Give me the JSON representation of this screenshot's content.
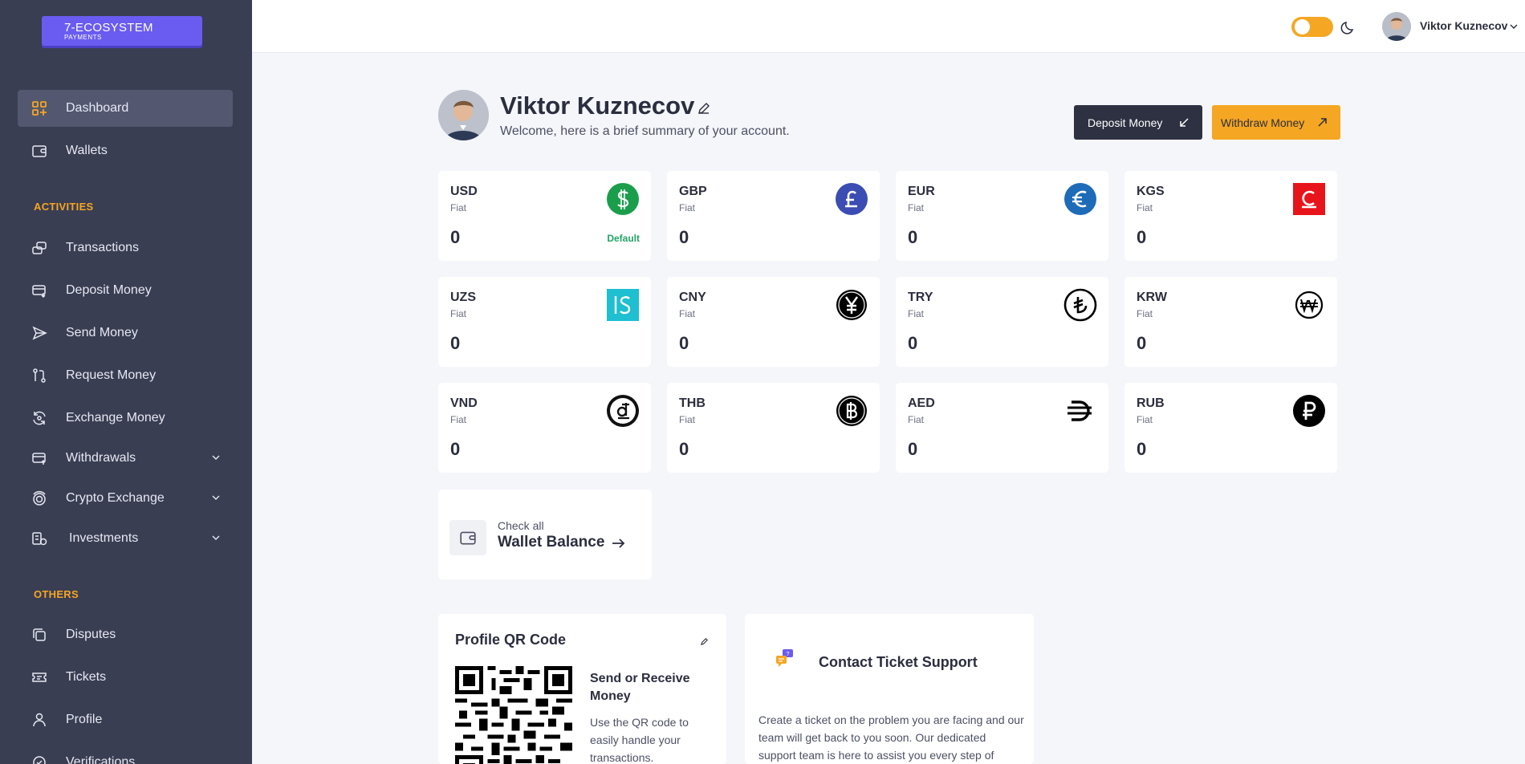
{
  "brand": {
    "line1": "7-ECOSYSTEM",
    "line2": "PAYMENTS"
  },
  "sidebar": {
    "main_items": [
      {
        "label": "Dashboard",
        "icon": "dashboard-icon"
      },
      {
        "label": "Wallets",
        "icon": "wallet-icon"
      }
    ],
    "activities_label": "ACTIVITIES",
    "activities": [
      {
        "label": "Transactions",
        "icon": "transactions-icon"
      },
      {
        "label": "Deposit Money",
        "icon": "deposit-icon"
      },
      {
        "label": "Send Money",
        "icon": "send-icon"
      },
      {
        "label": "Request Money",
        "icon": "request-icon"
      },
      {
        "label": "Exchange Money",
        "icon": "exchange-icon"
      },
      {
        "label": "Withdrawals",
        "icon": "withdrawals-icon"
      },
      {
        "label": "Crypto Exchange",
        "icon": "crypto-icon"
      },
      {
        "label": "Investments",
        "icon": "investments-icon"
      }
    ],
    "others_label": "OTHERS",
    "others": [
      {
        "label": "Disputes",
        "icon": "disputes-icon"
      },
      {
        "label": "Tickets",
        "icon": "tickets-icon"
      },
      {
        "label": "Profile",
        "icon": "profile-icon"
      },
      {
        "label": "Verifications",
        "icon": "verifications-icon"
      }
    ]
  },
  "topbar": {
    "user_name": "Viktor Kuznecov",
    "theme_toggle": "on"
  },
  "profile": {
    "name": "Viktor Kuznecov",
    "welcome": "Welcome, here is a brief summary of your account."
  },
  "actions": {
    "deposit": "Deposit Money",
    "withdraw": "Withdraw Money"
  },
  "currencies": [
    {
      "code": "USD",
      "type": "Fiat",
      "amount": "0",
      "default": "Default",
      "icon": "dollar-icon",
      "color": "#1a9e4b"
    },
    {
      "code": "GBP",
      "type": "Fiat",
      "amount": "0",
      "icon": "pound-icon",
      "color": "#3b4db3"
    },
    {
      "code": "EUR",
      "type": "Fiat",
      "amount": "0",
      "icon": "euro-icon",
      "color": "#1e6bb8"
    },
    {
      "code": "KGS",
      "type": "Fiat",
      "amount": "0",
      "icon": "som-icon",
      "color": "#e8141c"
    },
    {
      "code": "UZS",
      "type": "Fiat",
      "amount": "0",
      "icon": "sum-icon",
      "color": "#1dbfd0"
    },
    {
      "code": "CNY",
      "type": "Fiat",
      "amount": "0",
      "icon": "yuan-icon",
      "color": "#000000"
    },
    {
      "code": "TRY",
      "type": "Fiat",
      "amount": "0",
      "icon": "lira-icon",
      "color": "#000000"
    },
    {
      "code": "KRW",
      "type": "Fiat",
      "amount": "0",
      "icon": "won-icon",
      "color": "#000000"
    },
    {
      "code": "VND",
      "type": "Fiat",
      "amount": "0",
      "icon": "dong-icon",
      "color": "#000000"
    },
    {
      "code": "THB",
      "type": "Fiat",
      "amount": "0",
      "icon": "baht-icon",
      "color": "#000000"
    },
    {
      "code": "AED",
      "type": "Fiat",
      "amount": "0",
      "icon": "dirham-icon",
      "color": "#000000"
    },
    {
      "code": "RUB",
      "type": "Fiat",
      "amount": "0",
      "icon": "ruble-icon",
      "color": "#000000"
    }
  ],
  "wallet_balance": {
    "line1": "Check all",
    "line2": "Wallet Balance"
  },
  "qr_panel": {
    "title": "Profile QR Code",
    "heading": "Send or Receive Money",
    "description": "Use the QR code to easily handle your transactions."
  },
  "support_panel": {
    "title": "Contact Ticket Support",
    "badge": "?",
    "description": "Create a ticket on the problem you are facing and our team will get back to you soon. Our dedicated support team is here to assist you every step of"
  },
  "colors": {
    "sidebar_bg": "#3a3e52",
    "accent": "#f5a623",
    "brand": "#6a5cf0",
    "dark_button": "#2e3142",
    "page_bg": "#f5f6fa"
  }
}
